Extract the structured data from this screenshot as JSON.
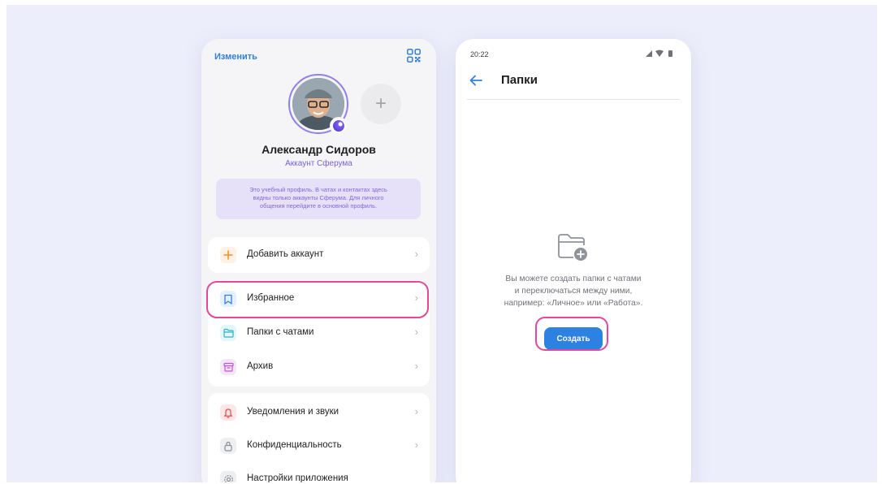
{
  "profile": {
    "edit_label": "Изменить",
    "name": "Александр Сидоров",
    "account_type": "Аккаунт Сферума",
    "notice_line1": "Это учебный профиль. В чатах и контактах здесь",
    "notice_line2": "видны только аккаунты Сферума. Для личного",
    "notice_line3": "общения перейдите в основной профиль.",
    "add_symbol": "+"
  },
  "menu": {
    "add_account": "Добавить аккаунт",
    "favorites": "Избранное",
    "chat_folders": "Папки с чатами",
    "archive": "Архив",
    "notifications": "Уведомления и звуки",
    "privacy": "Конфиденциальность",
    "app_settings": "Настройки приложения",
    "chevron": "›"
  },
  "folders_screen": {
    "status_time": "20:22",
    "title": "Папки",
    "empty_line1": "Вы можете создать папки с чатами",
    "empty_line2": "и переключаться между ними,",
    "empty_line3": "например: «Личное» или «Работа».",
    "create_label": "Создать"
  },
  "icons": {
    "edit": "qr-code-icon",
    "add_account": "plus-icon",
    "favorites": "bookmark-icon",
    "chat_folders": "folder-icon",
    "archive": "archive-box-icon",
    "notifications": "bell-icon",
    "privacy": "lock-icon",
    "app_settings": "gear-icon",
    "back": "arrow-left-icon",
    "empty": "folder-add-icon"
  },
  "colors": {
    "accent": "#2d81e0",
    "sferum": "#7a5fe0",
    "highlight": "#e8459b",
    "background": "#eceefb"
  }
}
